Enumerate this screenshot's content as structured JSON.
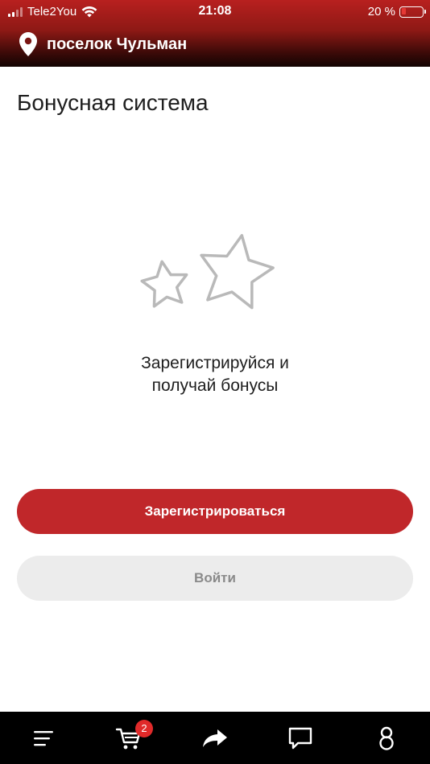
{
  "status_bar": {
    "carrier": "Tele2You",
    "time": "21:08",
    "battery_percent_label": "20 %",
    "battery_level": 0.2,
    "signal_bars": 2
  },
  "header": {
    "location": "поселок Чульман",
    "icon": "location-pin-icon"
  },
  "page": {
    "title": "Бонусная система",
    "illustration_icon": "stars-icon",
    "promo_line1": "Зарегистрируйся и",
    "promo_line2": "получай бонусы"
  },
  "actions": {
    "register_label": "Зарегистрироваться",
    "login_label": "Войти"
  },
  "tabbar": {
    "items": [
      {
        "icon": "menu-icon"
      },
      {
        "icon": "cart-icon",
        "badge": "2"
      },
      {
        "icon": "share-icon"
      },
      {
        "icon": "chat-icon"
      },
      {
        "icon": "profile-icon"
      }
    ]
  },
  "colors": {
    "brand_red": "#c0272a",
    "header_dark": "#120302",
    "badge_red": "#e02a2a",
    "secondary_button": "#ececec"
  }
}
